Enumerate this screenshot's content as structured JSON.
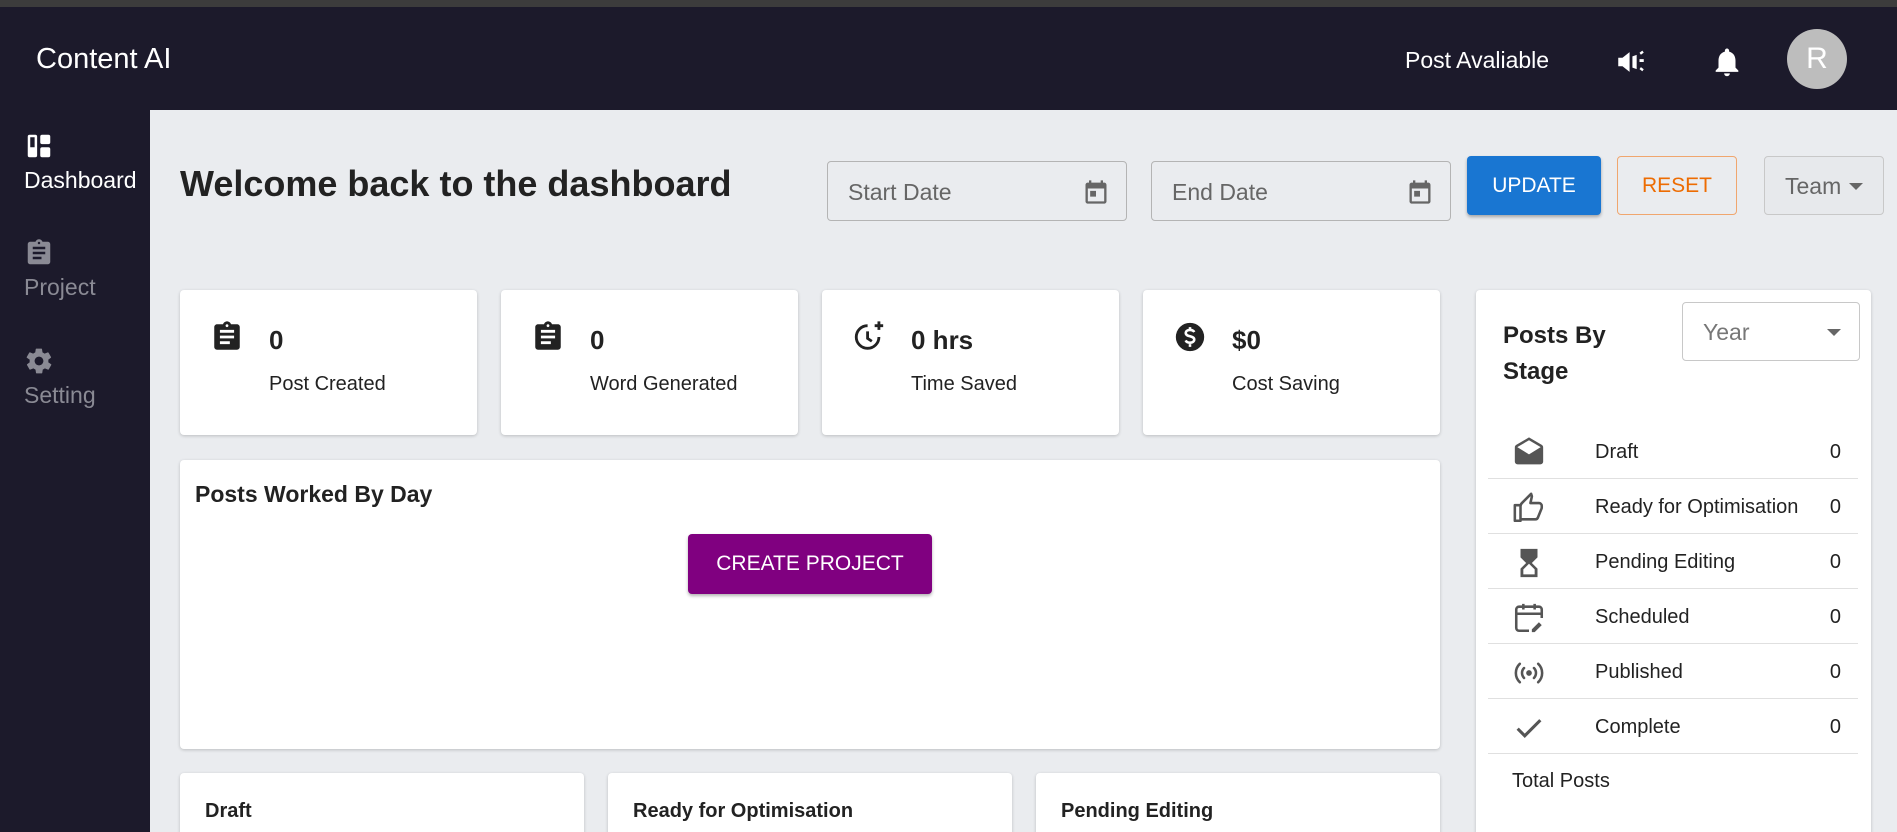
{
  "app": {
    "title": "Content AI",
    "post_available": "Post Avaliable",
    "avatar_initial": "R"
  },
  "sidebar": {
    "items": [
      {
        "label": "Dashboard",
        "icon": "dashboard-icon",
        "active": true
      },
      {
        "label": "Project",
        "icon": "clipboard-icon",
        "active": false
      },
      {
        "label": "Setting",
        "icon": "gear-icon",
        "active": false
      }
    ]
  },
  "header": {
    "welcome": "Welcome back to the dashboard",
    "start_date_placeholder": "Start Date",
    "end_date_placeholder": "End Date",
    "update_label": "UPDATE",
    "reset_label": "RESET",
    "team_label": "Team"
  },
  "stats": [
    {
      "value": "0",
      "label": "Post Created",
      "icon": "clipboard-icon"
    },
    {
      "value": "0",
      "label": "Word Generated",
      "icon": "clipboard-icon"
    },
    {
      "value": "0 hrs",
      "label": "Time Saved",
      "icon": "clock-plus-icon"
    },
    {
      "value": "$0",
      "label": "Cost Saving",
      "icon": "dollar-icon"
    }
  ],
  "posts_by_day": {
    "title": "Posts Worked By Day",
    "create_label": "CREATE PROJECT"
  },
  "bottom_cards": [
    {
      "title": "Draft"
    },
    {
      "title": "Ready for Optimisation"
    },
    {
      "title": "Pending Editing"
    }
  ],
  "posts_by_stage": {
    "title": "Posts By Stage",
    "period": "Year",
    "rows": [
      {
        "label": "Draft",
        "value": "0",
        "icon": "envelope-open-icon"
      },
      {
        "label": "Ready for Optimisation",
        "value": "0",
        "icon": "thumbs-up-icon"
      },
      {
        "label": "Pending Editing",
        "value": "0",
        "icon": "hourglass-icon"
      },
      {
        "label": "Scheduled",
        "value": "0",
        "icon": "calendar-edit-icon"
      },
      {
        "label": "Published",
        "value": "0",
        "icon": "broadcast-icon"
      },
      {
        "label": "Complete",
        "value": "0",
        "icon": "check-icon"
      }
    ],
    "total_label": "Total Posts"
  },
  "colors": {
    "topbar": "#1c1a2b",
    "update": "#1976d2",
    "reset": "#ed6c02",
    "create": "#800080"
  }
}
